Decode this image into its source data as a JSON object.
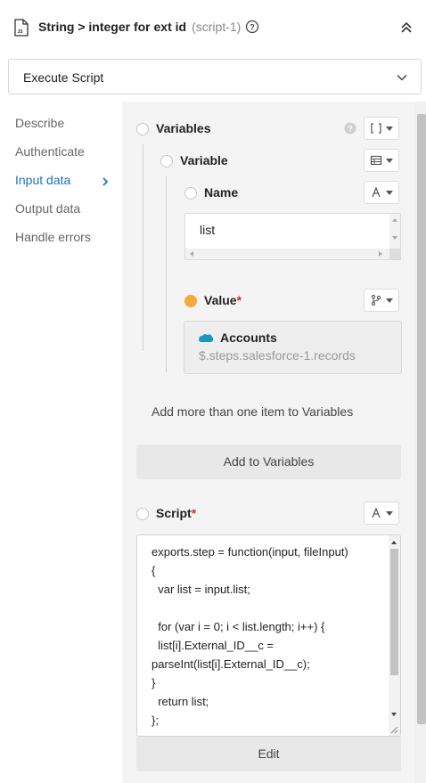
{
  "header": {
    "title": "String > integer for ext id",
    "subtitle": "(script-1)"
  },
  "action": {
    "selected": "Execute Script"
  },
  "sidebar": {
    "items": [
      {
        "label": "Describe"
      },
      {
        "label": "Authenticate"
      },
      {
        "label": "Input data"
      },
      {
        "label": "Output data"
      },
      {
        "label": "Handle errors"
      }
    ],
    "active_index": 2
  },
  "fields": {
    "variables_label": "Variables",
    "variable_label": "Variable",
    "name_label": "Name",
    "name_value": "list",
    "value_label": "Value",
    "required_mark": "*",
    "value_card": {
      "title": "Accounts",
      "path": "$.steps.salesforce-1.records"
    },
    "add_hint": "Add more than one item to Variables",
    "add_button": "Add to Variables",
    "script_label": "Script",
    "script_lines": [
      "exports.step = function(input, fileInput)",
      "{",
      "  var list = input.list;",
      "",
      "  for (var i = 0; i < list.length; i++) {",
      "  list[i].External_ID__c =",
      "parseInt(list[i].External_ID__c);",
      "}",
      "  return list;",
      "};"
    ],
    "edit_button": "Edit"
  },
  "colors": {
    "accent": "#1a73c8",
    "required": "#d32f2f",
    "value_indicator": "#f4a93b",
    "panel_bg": "#f4f4f4",
    "salesforce": "#1798c1"
  },
  "icons": [
    "js-file-icon",
    "help-icon",
    "collapse-icon",
    "chevron-down-icon",
    "chevron-right-icon",
    "array-icon",
    "table-icon",
    "text-icon",
    "branch-icon",
    "salesforce-cloud-icon"
  ]
}
